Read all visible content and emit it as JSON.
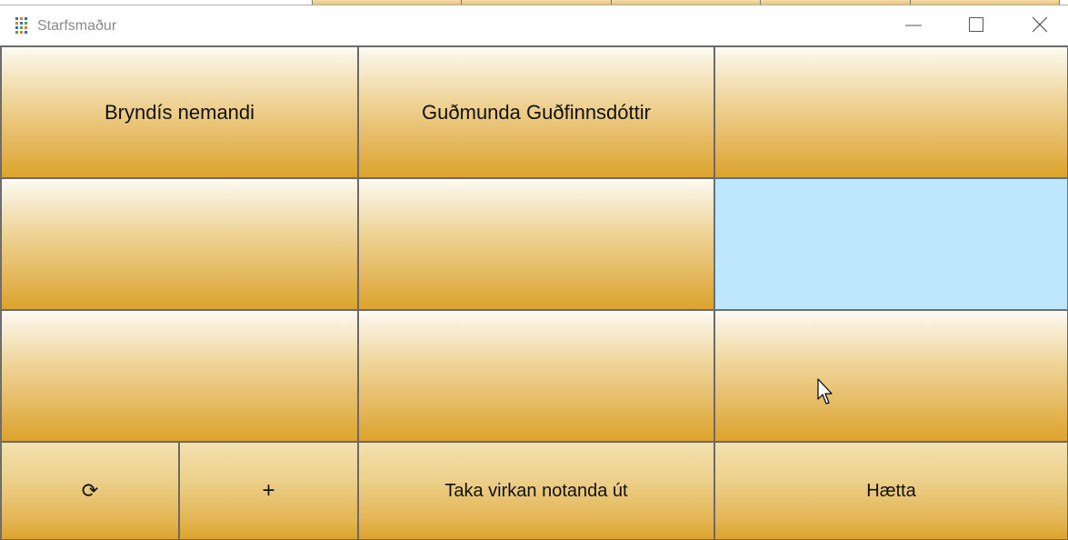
{
  "window": {
    "title": "Starfsmaður",
    "icon": "grid-app-icon",
    "controls": {
      "minimize": "minimize-icon",
      "maximize": "maximize-icon",
      "close": "close-icon"
    }
  },
  "users": [
    {
      "label": "Bryndís nemandi",
      "selected": false
    },
    {
      "label": "Guðmunda Guðfinnsdóttir",
      "selected": false
    },
    {
      "label": "",
      "selected": false
    },
    {
      "label": "",
      "selected": false
    },
    {
      "label": "",
      "selected": false
    },
    {
      "label": "",
      "selected": true
    },
    {
      "label": "",
      "selected": false
    },
    {
      "label": "",
      "selected": false
    },
    {
      "label": "",
      "selected": false
    }
  ],
  "toolbar": {
    "refresh_icon": "refresh-icon",
    "refresh_label": "⟳",
    "add_label": "+",
    "logout_label": "Taka virkan notanda út",
    "quit_label": "Hætta"
  },
  "colors": {
    "button_gradient_top": "#fdfaf2",
    "button_gradient_bottom": "#dca42b",
    "selected": "#bee6fd"
  }
}
